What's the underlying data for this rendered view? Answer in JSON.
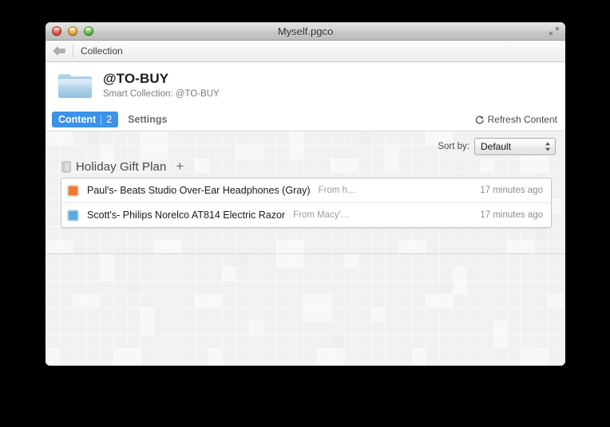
{
  "window": {
    "title": "Myself.pgco",
    "traffic_lights": [
      "close-button",
      "minimize-button",
      "zoom-button"
    ],
    "fullscreen_icon": "fullscreen-icon"
  },
  "navbar": {
    "back_icon": "back-arrow-icon",
    "breadcrumb": "Collection"
  },
  "collection": {
    "icon": "folder-icon",
    "title": "@TO-BUY",
    "subtitle": "Smart Collection: @TO-BUY"
  },
  "tabs": {
    "content": {
      "label": "Content",
      "count": "2"
    },
    "settings": {
      "label": "Settings"
    },
    "refresh": {
      "label": "Refresh Content",
      "icon": "refresh-icon"
    }
  },
  "sort": {
    "label": "Sort by:",
    "value": "Default",
    "options": [
      "Default"
    ]
  },
  "group": {
    "icon": "note-icon",
    "title": "Holiday Gift Plan",
    "add_label": "+"
  },
  "list": {
    "rows": [
      {
        "swatch_color": "#ED7A33",
        "title": "Paul's- Beats Studio Over-Ear Headphones (Gray)",
        "source": "From h…",
        "time": "17 minutes ago"
      },
      {
        "swatch_color": "#5AABE3",
        "title": "Scott's- Philips Norelco AT814 Electric Razor",
        "source": "From Macy'…",
        "time": "17 minutes ago"
      }
    ]
  },
  "colors": {
    "accent": "#3B92E8",
    "window_bg": "#ECECEC",
    "panel_bg": "#FFFFFF"
  }
}
